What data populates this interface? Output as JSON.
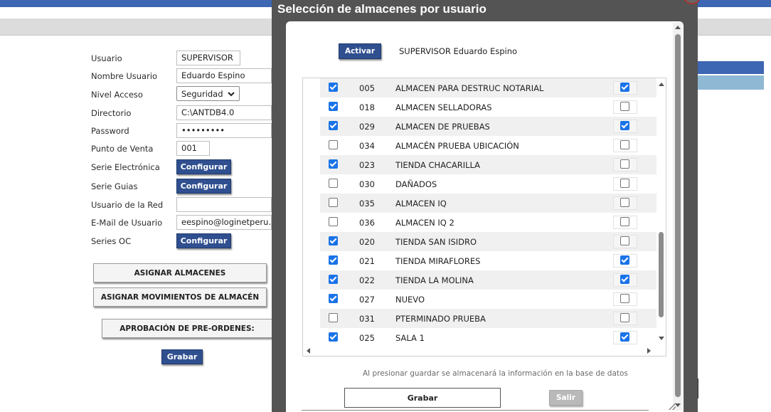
{
  "background_form": {
    "fields": [
      {
        "label": "Usuario",
        "value": "SUPERVISOR"
      },
      {
        "label": "Nombre Usuario",
        "value": "Eduardo Espino"
      },
      {
        "label": "Nivel Acceso",
        "value": "Seguridad"
      },
      {
        "label": "Directorio",
        "value": "C:\\ANTDB4.0"
      },
      {
        "label": "Password",
        "value": "•••••••••"
      },
      {
        "label": "Punto de Venta",
        "value": "001"
      },
      {
        "label": "Serie Electrónica",
        "button": "Configurar"
      },
      {
        "label": "Serie Guias",
        "button": "Configurar"
      },
      {
        "label": "Usuario de la Red",
        "value": ""
      },
      {
        "label": "E-Mail de Usuario",
        "value": "eespino@loginetperu.co"
      },
      {
        "label": "Series OC",
        "button": "Configurar"
      }
    ],
    "asignar_almacenes": "ASIGNAR ALMACENES",
    "asignar_movimientos": "ASIGNAR MOVIMIENTOS DE ALMACÉN",
    "aprobacion": "APROBACIÓN DE PRE-ORDENES:",
    "grabar": "Grabar"
  },
  "modal": {
    "title": "Selección de almacenes por usuario",
    "activar_label": "Activar",
    "user_info": "SUPERVISOR  Eduardo Espino",
    "note": "Al presionar guardar se almacenará la información en la base de datos",
    "grabar_label": "Grabar",
    "salir_label": "Salir",
    "rows": [
      {
        "selected": true,
        "code": "005",
        "name": "ALMACEN PARA DESTRUC NOTARIAL",
        "flag": true
      },
      {
        "selected": true,
        "code": "018",
        "name": "ALMACEN SELLADORAS",
        "flag": false
      },
      {
        "selected": true,
        "code": "029",
        "name": "ALMACEN DE PRUEBAS",
        "flag": true
      },
      {
        "selected": false,
        "code": "034",
        "name": "ALMACÉN PRUEBA UBICACIÓN",
        "flag": false
      },
      {
        "selected": true,
        "code": "023",
        "name": "TIENDA CHACARILLA",
        "flag": false
      },
      {
        "selected": false,
        "code": "030",
        "name": "DAÑADOS",
        "flag": false
      },
      {
        "selected": false,
        "code": "035",
        "name": "ALMACEN IQ",
        "flag": false
      },
      {
        "selected": false,
        "code": "036",
        "name": "ALMACEN IQ 2",
        "flag": false
      },
      {
        "selected": true,
        "code": "020",
        "name": "TIENDA SAN ISIDRO",
        "flag": false
      },
      {
        "selected": true,
        "code": "021",
        "name": "TIENDA MIRAFLORES",
        "flag": true
      },
      {
        "selected": true,
        "code": "022",
        "name": "TIENDA LA MOLINA",
        "flag": true
      },
      {
        "selected": true,
        "code": "027",
        "name": "NUEVO",
        "flag": false
      },
      {
        "selected": false,
        "code": "031",
        "name": "PTERMINADO PRUEBA",
        "flag": false
      },
      {
        "selected": true,
        "code": "025",
        "name": "SALA 1",
        "flag": true
      }
    ]
  },
  "colors": {
    "brand_blue": "#2f4f8f",
    "overlay": "#545454",
    "checkbox_on": "#1a73e8"
  }
}
